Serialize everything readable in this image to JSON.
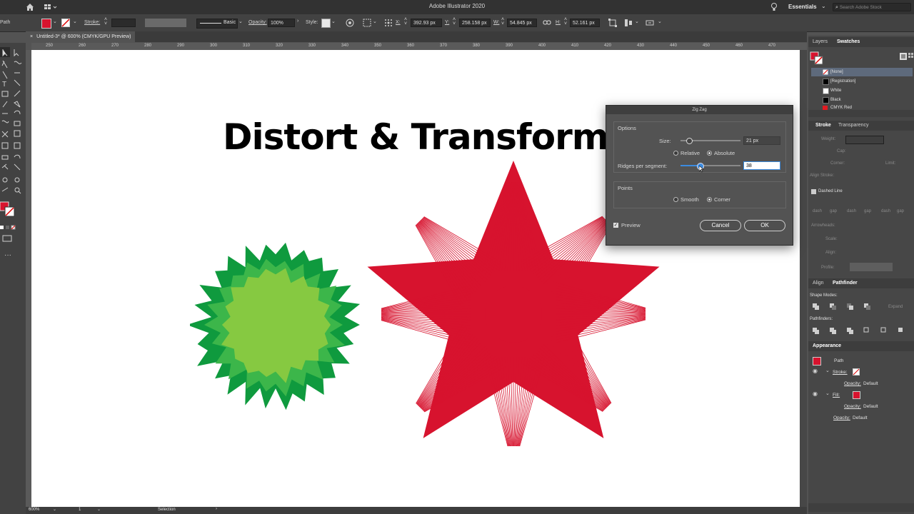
{
  "app": {
    "title": "Adobe Illustrator 2020",
    "workspace": "Essentials",
    "search_placeholder": "Search Adobe Stock"
  },
  "control_bar": {
    "object_type": "Path",
    "stroke_label": "Stroke:",
    "brush_label": "Basic",
    "opacity_label": "Opacity:",
    "opacity_value": "100%",
    "style_label": "Style:",
    "x_label": "X:",
    "x_value": "392.93 px",
    "y_label": "Y:",
    "y_value": "258.158 px",
    "w_label": "W:",
    "w_value": "54.845 px",
    "h_label": "H:",
    "h_value": "52.161 px"
  },
  "document": {
    "tab_label": "Untitled-3* @ 600% (CMYK/GPU Preview)",
    "zoom": "600%",
    "artboard": "1",
    "status": "Selection"
  },
  "ruler_ticks": [
    "250",
    "260",
    "270",
    "280",
    "290",
    "300",
    "310",
    "320",
    "330",
    "340",
    "350",
    "360",
    "370",
    "380",
    "390",
    "400",
    "410",
    "420",
    "430",
    "440",
    "450",
    "460",
    "470"
  ],
  "artwork": {
    "headline": "Distort & Transform",
    "colors": {
      "dark_green": "#0f9a3e",
      "mid_green": "#3cb64a",
      "light_green": "#86c941",
      "red": "#d7132e"
    }
  },
  "dialog": {
    "title": "Zig Zag",
    "options_label": "Options",
    "size_label": "Size:",
    "size_value": "21 px",
    "relative_label": "Relative",
    "absolute_label": "Absolute",
    "mode_selected": "Absolute",
    "ridges_label": "Ridges per segment:",
    "ridges_value": "38",
    "points_label": "Points",
    "smooth_label": "Smooth",
    "corner_label": "Corner",
    "points_selected": "Corner",
    "preview_label": "Preview",
    "preview_checked": true,
    "cancel_label": "Cancel",
    "ok_label": "OK"
  },
  "panels": {
    "tabs_top": [
      "Layers",
      "Swatches"
    ],
    "swatches": [
      {
        "name": "[None]",
        "color": "none"
      },
      {
        "name": "[Registration]",
        "color": "#000000"
      },
      {
        "name": "White",
        "color": "#ffffff"
      },
      {
        "name": "Black",
        "color": "#000000"
      },
      {
        "name": "CMYK Red",
        "color": "#e11b22"
      }
    ],
    "stroke_tabs": [
      "Stroke",
      "Transparency"
    ],
    "stroke": {
      "weight_label": "Weight:",
      "cap_label": "Cap:",
      "corner_label": "Corner:",
      "limit_label": "Limit:",
      "align_label": "Align Stroke:",
      "dashed_label": "Dashed Line",
      "dash_labels": [
        "dash",
        "gap",
        "dash",
        "gap",
        "dash",
        "gap"
      ],
      "arrowheads_label": "Arrowheads:",
      "scale_label": "Scale:",
      "align2_label": "Align:",
      "profile_label": "Profile:"
    },
    "align_tabs": [
      "Align",
      "Pathfinder"
    ],
    "pathfinder": {
      "shape_modes_label": "Shape Modes:",
      "expand_label": "Expand",
      "pathfinders_label": "Pathfinders:"
    },
    "appearance": {
      "title": "Appearance",
      "object": "Path",
      "stroke_label": "Stroke:",
      "fill_label": "Fill:",
      "opacity_label": "Opacity:",
      "opacity_value": "Default"
    }
  }
}
